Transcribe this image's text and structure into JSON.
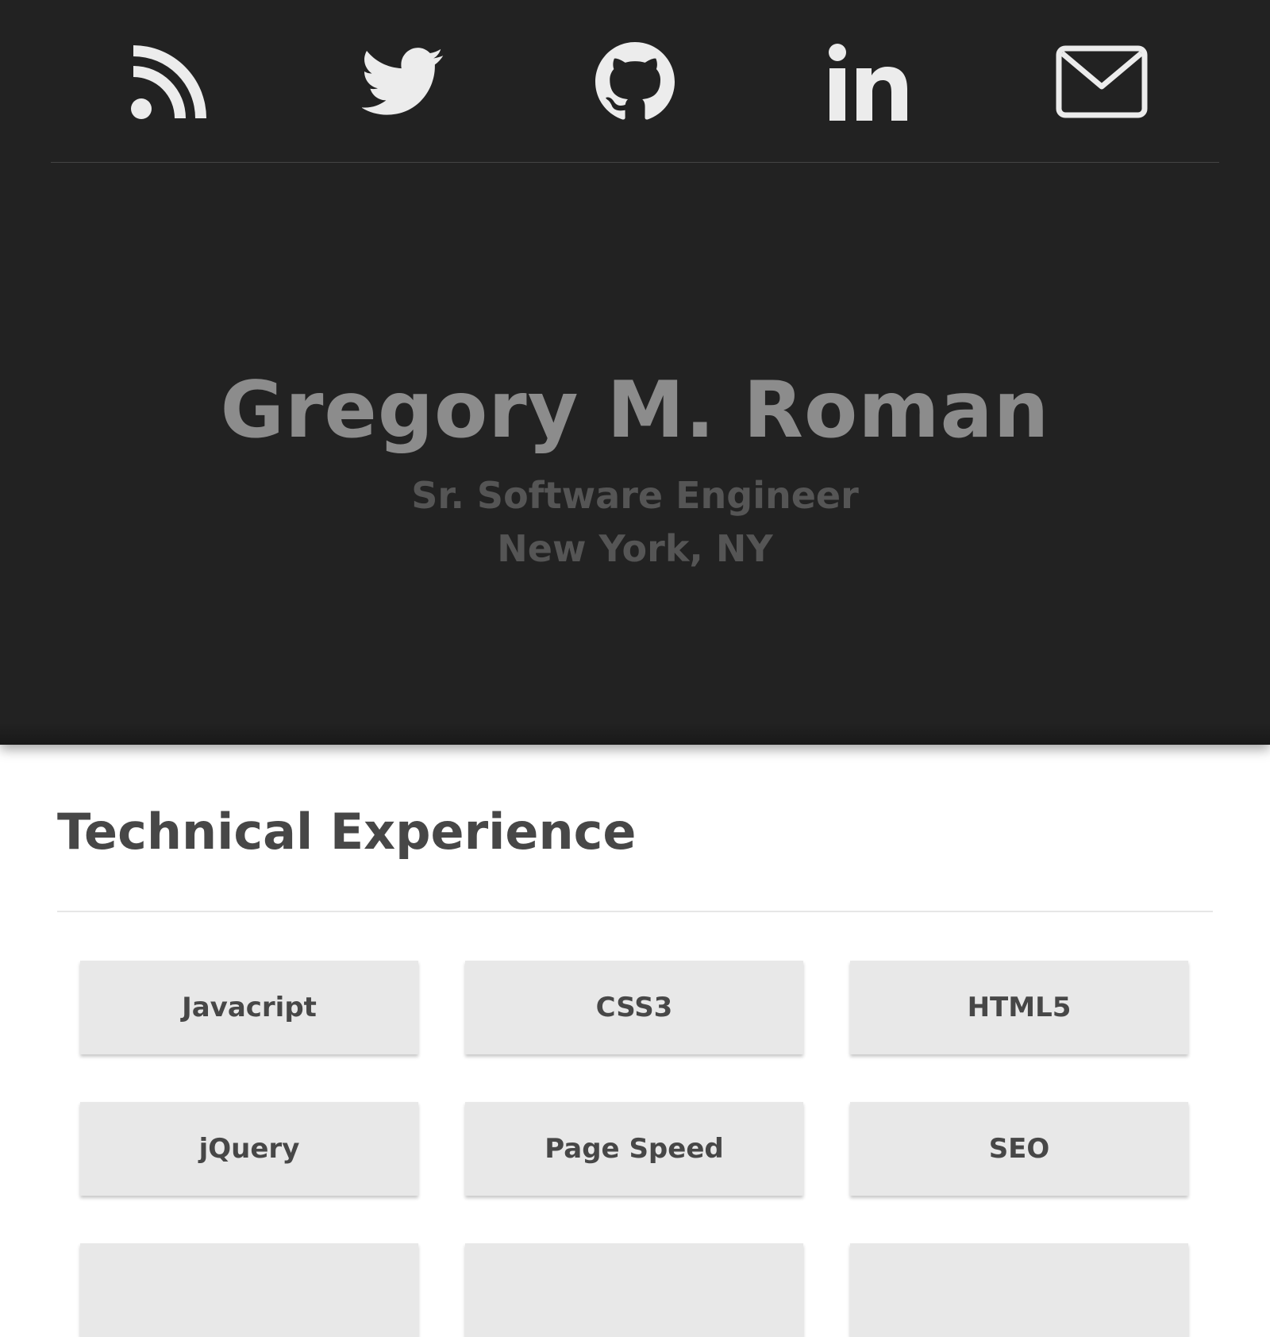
{
  "social": {
    "items": [
      {
        "icon": "rss-icon",
        "label": "RSS"
      },
      {
        "icon": "twitter-icon",
        "label": "Twitter"
      },
      {
        "icon": "github-icon",
        "label": "GitHub"
      },
      {
        "icon": "linkedin-icon",
        "label": "LinkedIn"
      },
      {
        "icon": "mail-icon",
        "label": "Email"
      }
    ],
    "icon_color": "#ececec"
  },
  "hero": {
    "name": "Gregory M. Roman",
    "title": "Sr. Software Engineer",
    "location": "New York, NY"
  },
  "technical": {
    "heading": "Technical Experience",
    "skills": [
      "Javacript",
      "CSS3",
      "HTML5",
      "jQuery",
      "Page Speed",
      "SEO",
      "",
      "",
      ""
    ]
  },
  "colors": {
    "header_bg": "#222222",
    "name_text": "#8c8c8c",
    "subtitle_text": "#555555",
    "heading_text": "#474747",
    "skill_bg": "#e8e8e8"
  }
}
